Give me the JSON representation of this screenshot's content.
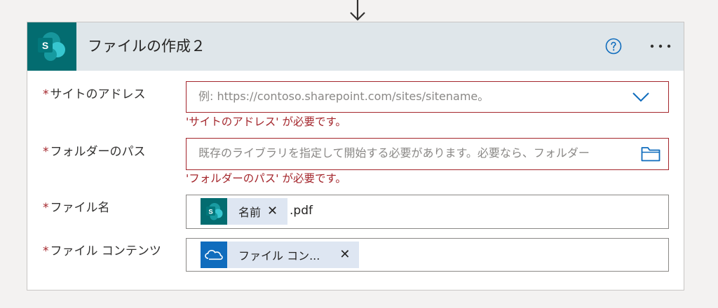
{
  "card": {
    "title": "ファイルの作成２",
    "help_icon": "help-circle-icon",
    "more_icon": "ellipsis-icon",
    "connector_icon": "sharepoint-icon"
  },
  "fields": {
    "site_address": {
      "label": "サイトのアドレス",
      "placeholder": "例: https://contoso.sharepoint.com/sites/sitename。",
      "error": "'サイトのアドレス' が必要です。"
    },
    "folder_path": {
      "label": "フォルダーのパス",
      "placeholder": "既存のライブラリを指定して開始する必要があります。必要なら、フォルダー",
      "error": "'フォルダーのパス' が必要です。"
    },
    "file_name": {
      "label": "ファイル名",
      "token": "名前",
      "token_icon": "sharepoint-icon",
      "suffix": ".pdf"
    },
    "file_content": {
      "label": "ファイル コンテンツ",
      "token": "ファイル コン...",
      "token_icon": "onedrive-icon"
    }
  },
  "required_mark": "*",
  "colors": {
    "header_bg": "#dfe6ea",
    "sharepoint": "#036c70",
    "onedrive": "#0f6cbd",
    "error": "#a4262c",
    "accent": "#0078d4",
    "token_bg": "#dee6f2"
  }
}
